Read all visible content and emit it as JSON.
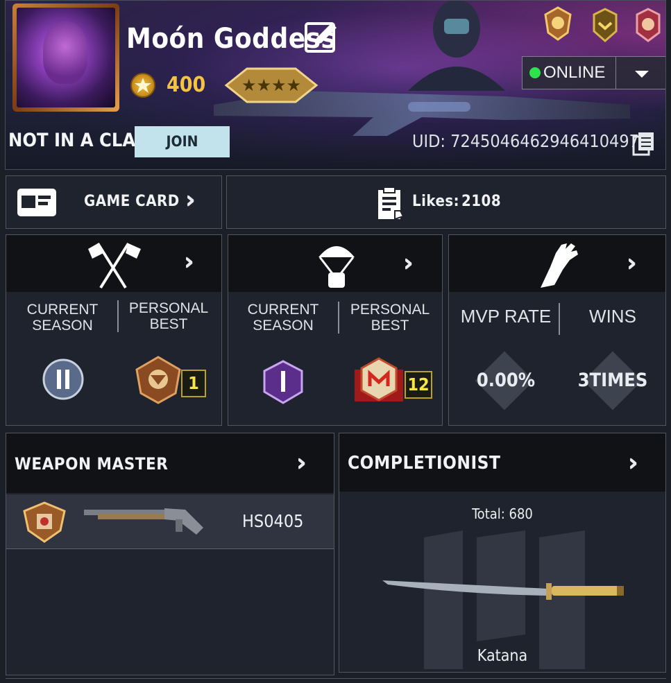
{
  "profile": {
    "name": "Moón Goddess",
    "coins": "400",
    "clan_status": "NOT IN A CLAN",
    "join_label": "JOIN",
    "uid": "UID: 7245046462946410497",
    "status": "ONLINE"
  },
  "game_card": {
    "label": "GAME CARD"
  },
  "likes": {
    "label": "Likes:",
    "value": "2108"
  },
  "mp_panel": {
    "current_label": [
      "CURRENT",
      "SEASON"
    ],
    "best_label": [
      "PERSONAL",
      "BEST"
    ],
    "best_count": "1"
  },
  "br_panel": {
    "current_label": [
      "CURRENT",
      "SEASON"
    ],
    "best_label": [
      "PERSONAL",
      "BEST"
    ],
    "best_count": "12"
  },
  "zombie_panel": {
    "mvp_label": "MVP RATE",
    "wins_label": "WINS",
    "mvp_value": "0.00%",
    "wins_value": "3TIMES"
  },
  "weapon_master": {
    "title": "WEAPON MASTER",
    "weapon": "HS0405"
  },
  "completionist": {
    "title": "COMPLETIONIST",
    "total": "Total: 680",
    "item": "Katana"
  },
  "colors": {
    "online_dot": "#2ee34a",
    "join_bg": "#c3e3ec",
    "badge_text": "#f7e64a"
  }
}
